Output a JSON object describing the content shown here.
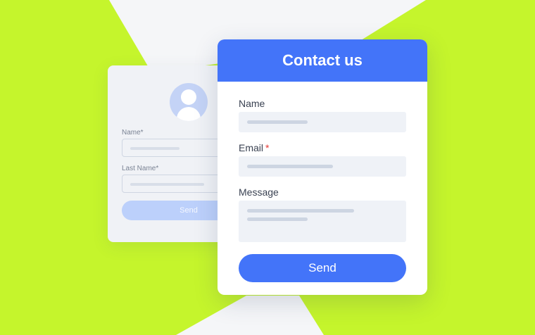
{
  "colors": {
    "background": "#c5f52c",
    "accent": "#4374f9",
    "back_card": "#f0f2f6",
    "required": "#e53935"
  },
  "back_form": {
    "avatar_icon": "user-avatar-icon",
    "fields": [
      {
        "label": "Name*"
      },
      {
        "label": "Last Name*"
      }
    ],
    "send_label": "Send"
  },
  "contact_form": {
    "title": "Contact us",
    "fields": [
      {
        "label": "Name",
        "required": false
      },
      {
        "label": "Email",
        "required": true,
        "required_marker": "*"
      },
      {
        "label": "Message",
        "required": false
      }
    ],
    "send_label": "Send"
  }
}
